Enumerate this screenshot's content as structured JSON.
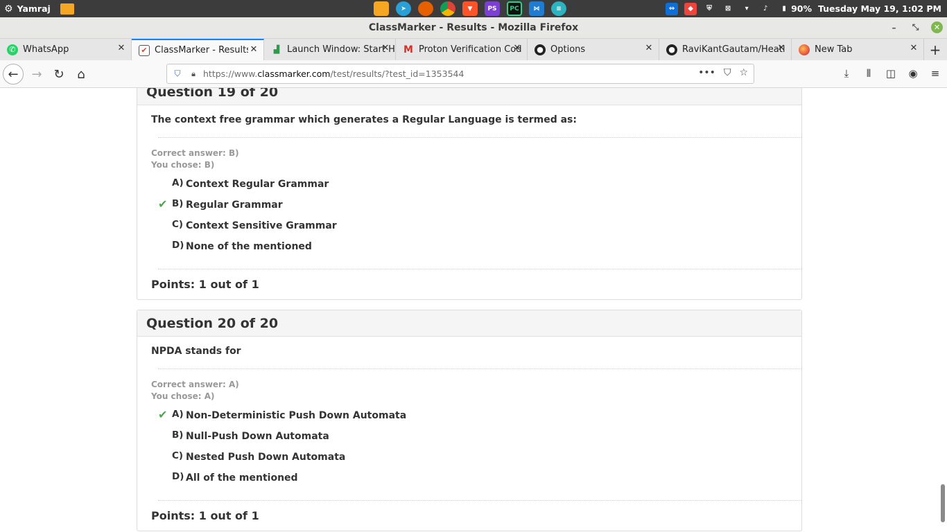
{
  "os": {
    "user": "Yamraj",
    "battery": "90%",
    "datetime": "Tuesday May 19,  1:02 PM"
  },
  "window": {
    "title": "ClassMarker - Results - Mozilla Firefox"
  },
  "tabs": [
    {
      "label": "WhatsApp",
      "icon": "whatsapp-icon"
    },
    {
      "label": "ClassMarker - Results",
      "icon": "classmarker-icon"
    },
    {
      "label": "Launch Window: Start H",
      "icon": "chart-icon"
    },
    {
      "label": "Proton Verification Cod",
      "icon": "gmail-icon"
    },
    {
      "label": "Options",
      "icon": "github-icon"
    },
    {
      "label": "RaviKantGautam/Heatl",
      "icon": "github-icon"
    },
    {
      "label": "New Tab",
      "icon": "firefox-icon"
    }
  ],
  "url": {
    "prefix": "https://www.",
    "domain": "classmarker.com",
    "path": "/test/results/?test_id=1353544"
  },
  "questions": [
    {
      "header": "Question 19 of 20",
      "text": "The context free grammar which generates a Regular Language is termed as:",
      "correct": "Correct answer: B)",
      "chose": "You chose: B)",
      "options": [
        {
          "letter": "A)",
          "text": "Context Regular Grammar",
          "check": ""
        },
        {
          "letter": "B)",
          "text": "Regular Grammar",
          "check": "✔"
        },
        {
          "letter": "C)",
          "text": "Context Sensitive Grammar",
          "check": ""
        },
        {
          "letter": "D)",
          "text": "None of the mentioned",
          "check": ""
        }
      ],
      "points": "Points: 1 out of 1"
    },
    {
      "header": "Question 20 of 20",
      "text": "NPDA stands for",
      "correct": "Correct answer: A)",
      "chose": "You chose: A)",
      "options": [
        {
          "letter": "A)",
          "text": "Non-Deterministic Push Down Automata",
          "check": "✔"
        },
        {
          "letter": "B)",
          "text": "Null-Push Down Automata",
          "check": ""
        },
        {
          "letter": "C)",
          "text": "Nested Push Down Automata",
          "check": ""
        },
        {
          "letter": "D)",
          "text": "All of the mentioned",
          "check": ""
        }
      ],
      "points": "Points: 1 out of 1"
    }
  ]
}
